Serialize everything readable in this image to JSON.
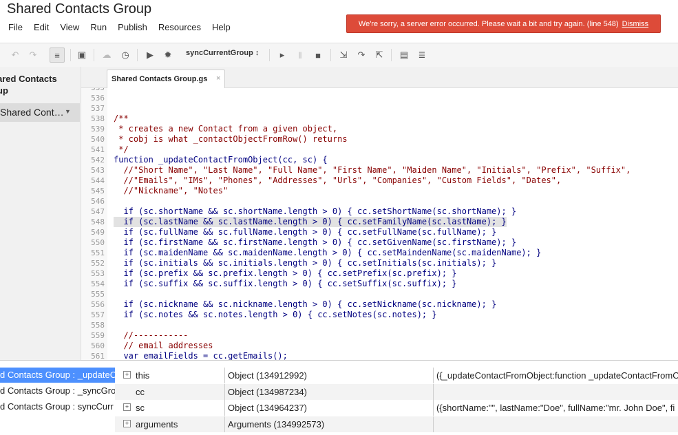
{
  "app": {
    "title": "Shared Contacts Group"
  },
  "menu": [
    "File",
    "Edit",
    "View",
    "Run",
    "Publish",
    "Resources",
    "Help"
  ],
  "error": {
    "message": "We're sorry, a server error occurred. Please wait a bit and try again. (line 548)",
    "dismiss": "Dismiss",
    "color": "#dd4b39"
  },
  "toolbar": {
    "function_select": "syncCurrentGroup ↕",
    "icons": [
      "undo-icon",
      "redo-icon",
      "indent-icon",
      "save-icon",
      "publish-cloud-icon",
      "triggers-clock-icon",
      "run-icon",
      "debug-bug-icon",
      "function-select",
      "continue-icon",
      "pause-icon",
      "stop-icon",
      "step-into-icon",
      "step-over-icon",
      "step-out-icon",
      "toggle-breakpoints-icon",
      "watch-icon"
    ]
  },
  "sidebar": {
    "project_name": "ared Contacts\nup",
    "file_item": "Shared Cont…",
    "file_item_arrow": "▼"
  },
  "editor": {
    "tab_label": "Shared Contacts Group.gs",
    "tab_close": "×",
    "highlight_line": 548,
    "lines": [
      {
        "n": "535",
        "text": "",
        "type": "blank"
      },
      {
        "n": "536",
        "text": "",
        "type": "blank"
      },
      {
        "n": "537",
        "text": "",
        "type": "blank"
      },
      {
        "n": "538",
        "text": "/**",
        "type": "comment"
      },
      {
        "n": "539",
        "text": " * creates a new Contact from a given object,",
        "type": "comment"
      },
      {
        "n": "540",
        "text": " * cobj is what _contactObjectFromRow() returns",
        "type": "comment"
      },
      {
        "n": "541",
        "text": " */",
        "type": "comment"
      },
      {
        "n": "542",
        "text": "function _updateContactFromObject(cc, sc) {",
        "type": "code"
      },
      {
        "n": "543",
        "text": "  //\"Short Name\", \"Last Name\", \"Full Name\", \"First Name\", \"Maiden Name\", \"Initials\", \"Prefix\", \"Suffix\",",
        "type": "comment"
      },
      {
        "n": "544",
        "text": "  //\"Emails\", \"IMs\", \"Phones\", \"Addresses\", \"Urls\", \"Companies\", \"Custom Fields\", \"Dates\",",
        "type": "comment"
      },
      {
        "n": "545",
        "text": "  //\"Nickname\", \"Notes\"",
        "type": "comment"
      },
      {
        "n": "546",
        "text": "",
        "type": "blank"
      },
      {
        "n": "547",
        "text": "  if (sc.shortName && sc.shortName.length > 0) { cc.setShortName(sc.shortName); }",
        "type": "code"
      },
      {
        "n": "548",
        "text": "  if (sc.lastName && sc.lastName.length > 0) { cc.setFamilyName(sc.lastName); }",
        "type": "code"
      },
      {
        "n": "549",
        "text": "  if (sc.fullName && sc.fullName.length > 0) { cc.setFullName(sc.fullName); }",
        "type": "code"
      },
      {
        "n": "550",
        "text": "  if (sc.firstName && sc.firstName.length > 0) { cc.setGivenName(sc.firstName); }",
        "type": "code"
      },
      {
        "n": "551",
        "text": "  if (sc.maidenName && sc.maidenName.length > 0) { cc.setMaindenName(sc.maidenName); }",
        "type": "code"
      },
      {
        "n": "552",
        "text": "  if (sc.initials && sc.initials.length > 0) { cc.setInitials(sc.initials); }",
        "type": "code"
      },
      {
        "n": "553",
        "text": "  if (sc.prefix && sc.prefix.length > 0) { cc.setPrefix(sc.prefix); }",
        "type": "code"
      },
      {
        "n": "554",
        "text": "  if (sc.suffix && sc.suffix.length > 0) { cc.setSuffix(sc.suffix); }",
        "type": "code"
      },
      {
        "n": "555",
        "text": "",
        "type": "blank"
      },
      {
        "n": "556",
        "text": "  if (sc.nickname && sc.nickname.length > 0) { cc.setNickname(sc.nickname); }",
        "type": "code"
      },
      {
        "n": "557",
        "text": "  if (sc.notes && sc.notes.length > 0) { cc.setNotes(sc.notes); }",
        "type": "code"
      },
      {
        "n": "558",
        "text": "",
        "type": "blank"
      },
      {
        "n": "559",
        "text": "  //-----------",
        "type": "comment"
      },
      {
        "n": "560",
        "text": "  // email addresses",
        "type": "comment"
      },
      {
        "n": "561",
        "text": "  var emailFields = cc.getEmails();",
        "type": "code"
      }
    ]
  },
  "debugger": {
    "stack": [
      "d Contacts Group : _updateC",
      "d Contacts Group : _syncGro",
      "d Contacts Group : syncCurr"
    ],
    "variables": [
      {
        "expand": "+",
        "name": "this",
        "value": "Object (134912992)",
        "detail": "({_updateContactFromObject:function _updateContactFromO"
      },
      {
        "expand": "",
        "name": "cc",
        "value": "Object (134987234)",
        "detail": ""
      },
      {
        "expand": "+",
        "name": "sc",
        "value": "Object (134964237)",
        "detail": "({shortName:\"\", lastName:\"Doe\", fullName:\"mr. John Doe\", fi"
      },
      {
        "expand": "+",
        "name": "arguments",
        "value": "Arguments (134992573)",
        "detail": ""
      }
    ]
  }
}
